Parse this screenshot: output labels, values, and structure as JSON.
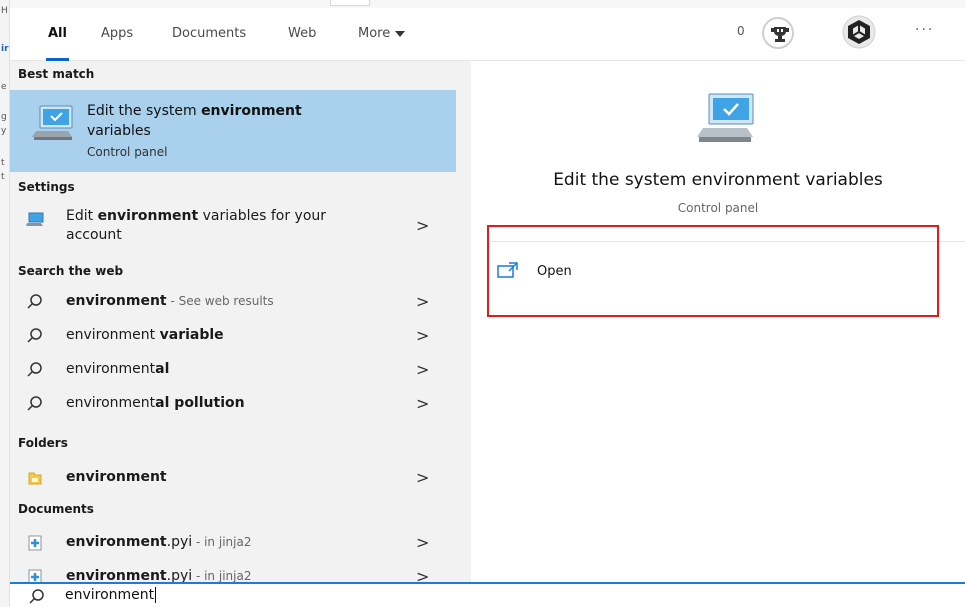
{
  "background_fragments": [
    "H",
    "ir",
    "e",
    "g",
    "y",
    "t",
    "t"
  ],
  "tabs": [
    {
      "label": "All",
      "active": true
    },
    {
      "label": "Apps",
      "active": false
    },
    {
      "label": "Documents",
      "active": false
    },
    {
      "label": "Web",
      "active": false
    },
    {
      "label": "More",
      "active": false
    }
  ],
  "header": {
    "points": "0",
    "trophy_icon": "trophy-icon",
    "app_icon": "unity-icon",
    "more_icon": "more-options-icon"
  },
  "sections": {
    "best_match": "Best match",
    "settings": "Settings",
    "search_web": "Search the web",
    "folders": "Folders",
    "documents": "Documents"
  },
  "best_match": {
    "title_pre": "Edit the system ",
    "title_bold": "environment",
    "title_post": "variables",
    "subtitle": "Control panel"
  },
  "settings_item": {
    "pre": "Edit ",
    "bold": "environment",
    "post": " variables for your account"
  },
  "web_items": [
    {
      "pre": "",
      "bold": "environment",
      "post": "",
      "hint": " - See web results"
    },
    {
      "pre": "environment ",
      "bold": "variable",
      "post": "",
      "hint": ""
    },
    {
      "pre": "environment",
      "bold": "al",
      "post": "",
      "hint": ""
    },
    {
      "pre": "environment",
      "bold": "al pollution",
      "post": "",
      "hint": ""
    }
  ],
  "folder_item": {
    "bold": "environment"
  },
  "doc_items": [
    {
      "bold": "environment",
      "post": ".pyi",
      "hint": " - in jinja2"
    },
    {
      "bold": "environment",
      "post": ".pyi",
      "hint": " - in jinja2"
    }
  ],
  "preview": {
    "title": "Edit the system environment variables",
    "subtitle": "Control panel",
    "open_label": "Open"
  },
  "search": {
    "value": "environment"
  },
  "colors": {
    "accent": "#0a64c8",
    "selection": "#a9d0ec",
    "highlight_box": "#e01c1c"
  }
}
